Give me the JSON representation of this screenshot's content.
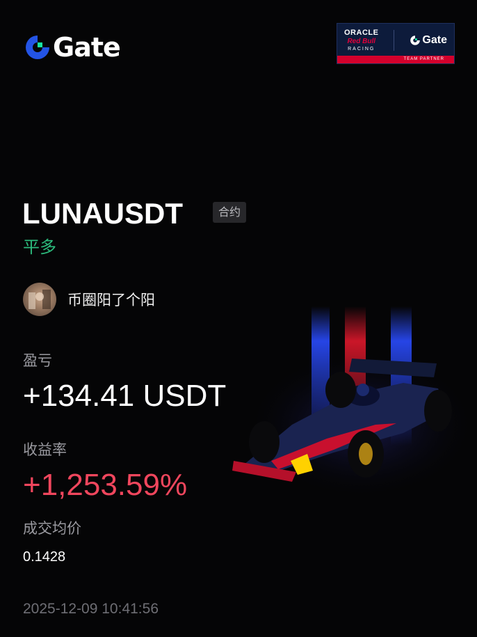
{
  "header": {
    "logo_text": "Gate",
    "partner": {
      "oracle": "ORACLE",
      "redbull": "Red Bull",
      "racing": "RACING",
      "gate": "Gate",
      "team_partner": "TEAM PARTNER"
    }
  },
  "position": {
    "pair": "LUNAUSDT",
    "type_tag": "合约",
    "side": "平多"
  },
  "user": {
    "name": "币圈阳了个阳"
  },
  "stats": {
    "pnl_label": "盈亏",
    "pnl_value": "+134.41 USDT",
    "roi_label": "收益率",
    "roi_value": "+1,253.59%",
    "avg_label": "成交均价",
    "avg_value": "0.1428"
  },
  "timestamp": "2025-12-09 10:41:56",
  "colors": {
    "accent_green": "#2cbc7d",
    "accent_red": "#f0465d",
    "gate_blue": "#2354e6",
    "gate_green": "#17e6a1"
  }
}
